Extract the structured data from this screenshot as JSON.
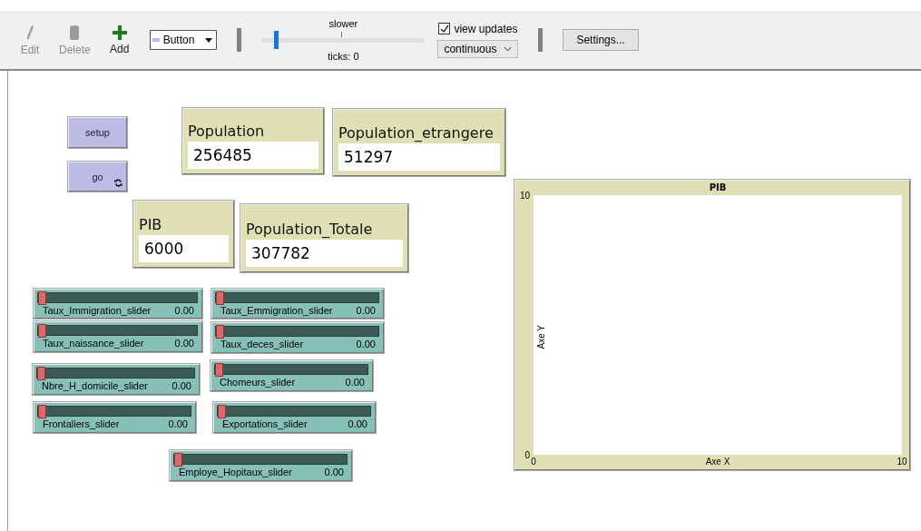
{
  "toolbar": {
    "tools": [
      {
        "kind": "edit",
        "label": "Edit",
        "disabled": true
      },
      {
        "kind": "delete",
        "label": "Delete",
        "disabled": true
      },
      {
        "kind": "add",
        "label": "Add",
        "disabled": false
      }
    ],
    "widget_type": "Button",
    "speed": {
      "label": "slower",
      "level": 0.08,
      "ticks": "ticks: 0"
    },
    "view_updates": {
      "label": "view updates",
      "checked": true
    },
    "update_mode": "continuous",
    "settings": "Settings..."
  },
  "buttons": [
    {
      "label": "setup",
      "forever": false
    },
    {
      "label": "go",
      "forever": true
    }
  ],
  "monitors": [
    {
      "label": "Population",
      "value": "256485"
    },
    {
      "label": "Population_etrangere",
      "value": "51297"
    },
    {
      "label": "PIB",
      "value": "6000"
    },
    {
      "label": "Population_Totale",
      "value": "307782"
    }
  ],
  "sliders": [
    {
      "label": "Taux_Immigration_slider",
      "value": "0.00",
      "level": 0
    },
    {
      "label": "Taux_Emmigration_slider",
      "value": "0.00",
      "level": 0
    },
    {
      "label": "Taux_naissance_slider",
      "value": "0.00",
      "level": 0
    },
    {
      "label": "Taux_deces_slider",
      "value": "0.00",
      "level": 0
    },
    {
      "label": "Nbre_H_domicile_slider",
      "value": "0.00",
      "level": 0
    },
    {
      "label": "Chomeurs_slider",
      "value": "0.00",
      "level": 0
    },
    {
      "label": "Frontaliers_slider",
      "value": "0.00",
      "level": 0
    },
    {
      "label": "Exportations_slider",
      "value": "0.00",
      "level": 0
    },
    {
      "label": "Employe_Hopitaux_slider",
      "value": "0.00",
      "level": 0
    }
  ],
  "plot": {
    "chart_data": {
      "type": "line",
      "title": "PIB",
      "xlabel": "Axe X",
      "ylabel": "Axe Y",
      "xlim": [
        0,
        10
      ],
      "ylim": [
        0,
        10
      ],
      "xticks": [
        0,
        10
      ],
      "yticks": [
        0,
        10
      ]
    }
  }
}
